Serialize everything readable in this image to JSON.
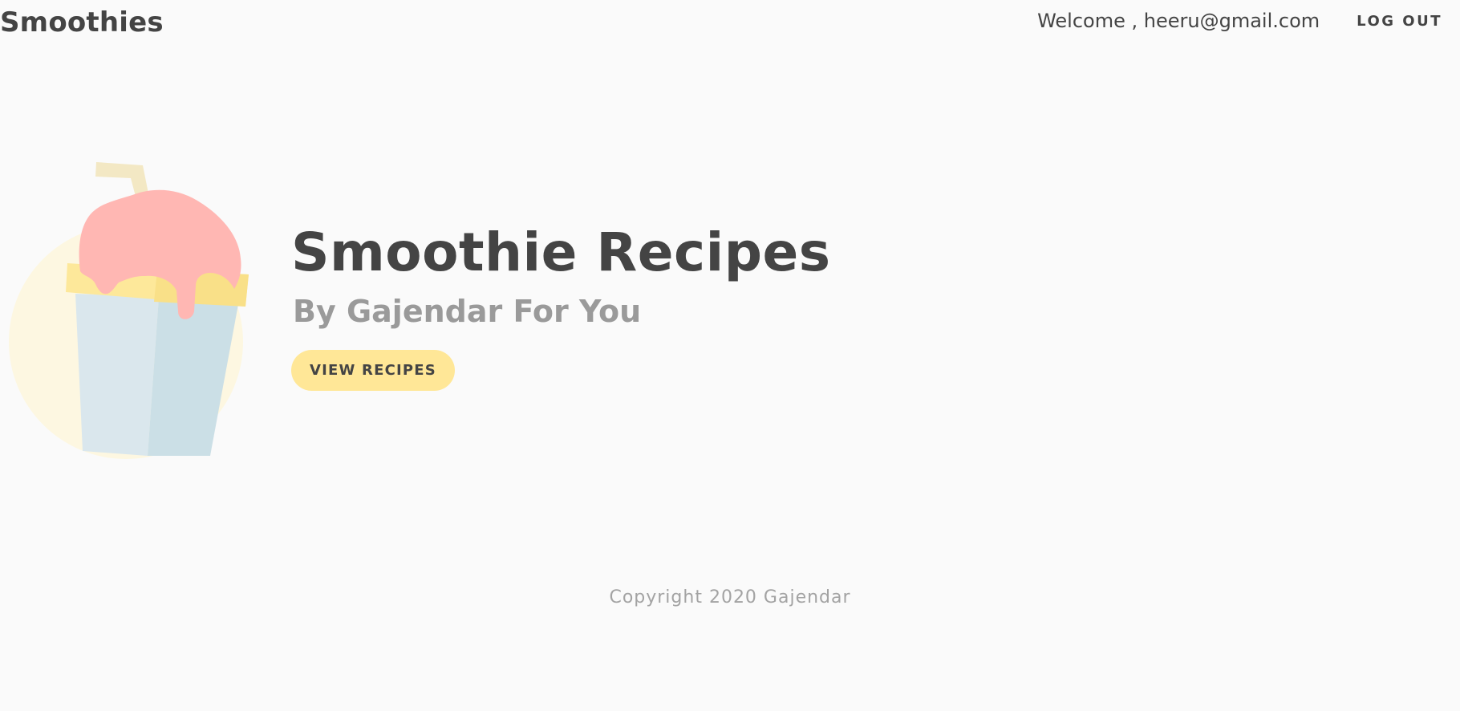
{
  "nav": {
    "brand": "Smoothies",
    "welcome": "Welcome , heeru@gmail.com",
    "logout": "LOG OUT"
  },
  "hero": {
    "title": "Smoothie Recipes",
    "subtitle": "By Gajendar For You",
    "button_label": "VIEW RECIPES",
    "image_icon": "smoothie-cup-icon"
  },
  "footer": {
    "text": "Copyright 2020 Gajendar"
  },
  "colors": {
    "background": "#fafafa",
    "text": "#444444",
    "muted": "#9a9a9a",
    "button_bg": "#ffe797",
    "cup": "#d8e6ec",
    "topping": "#ffb7b3",
    "lid": "#fde89a"
  }
}
